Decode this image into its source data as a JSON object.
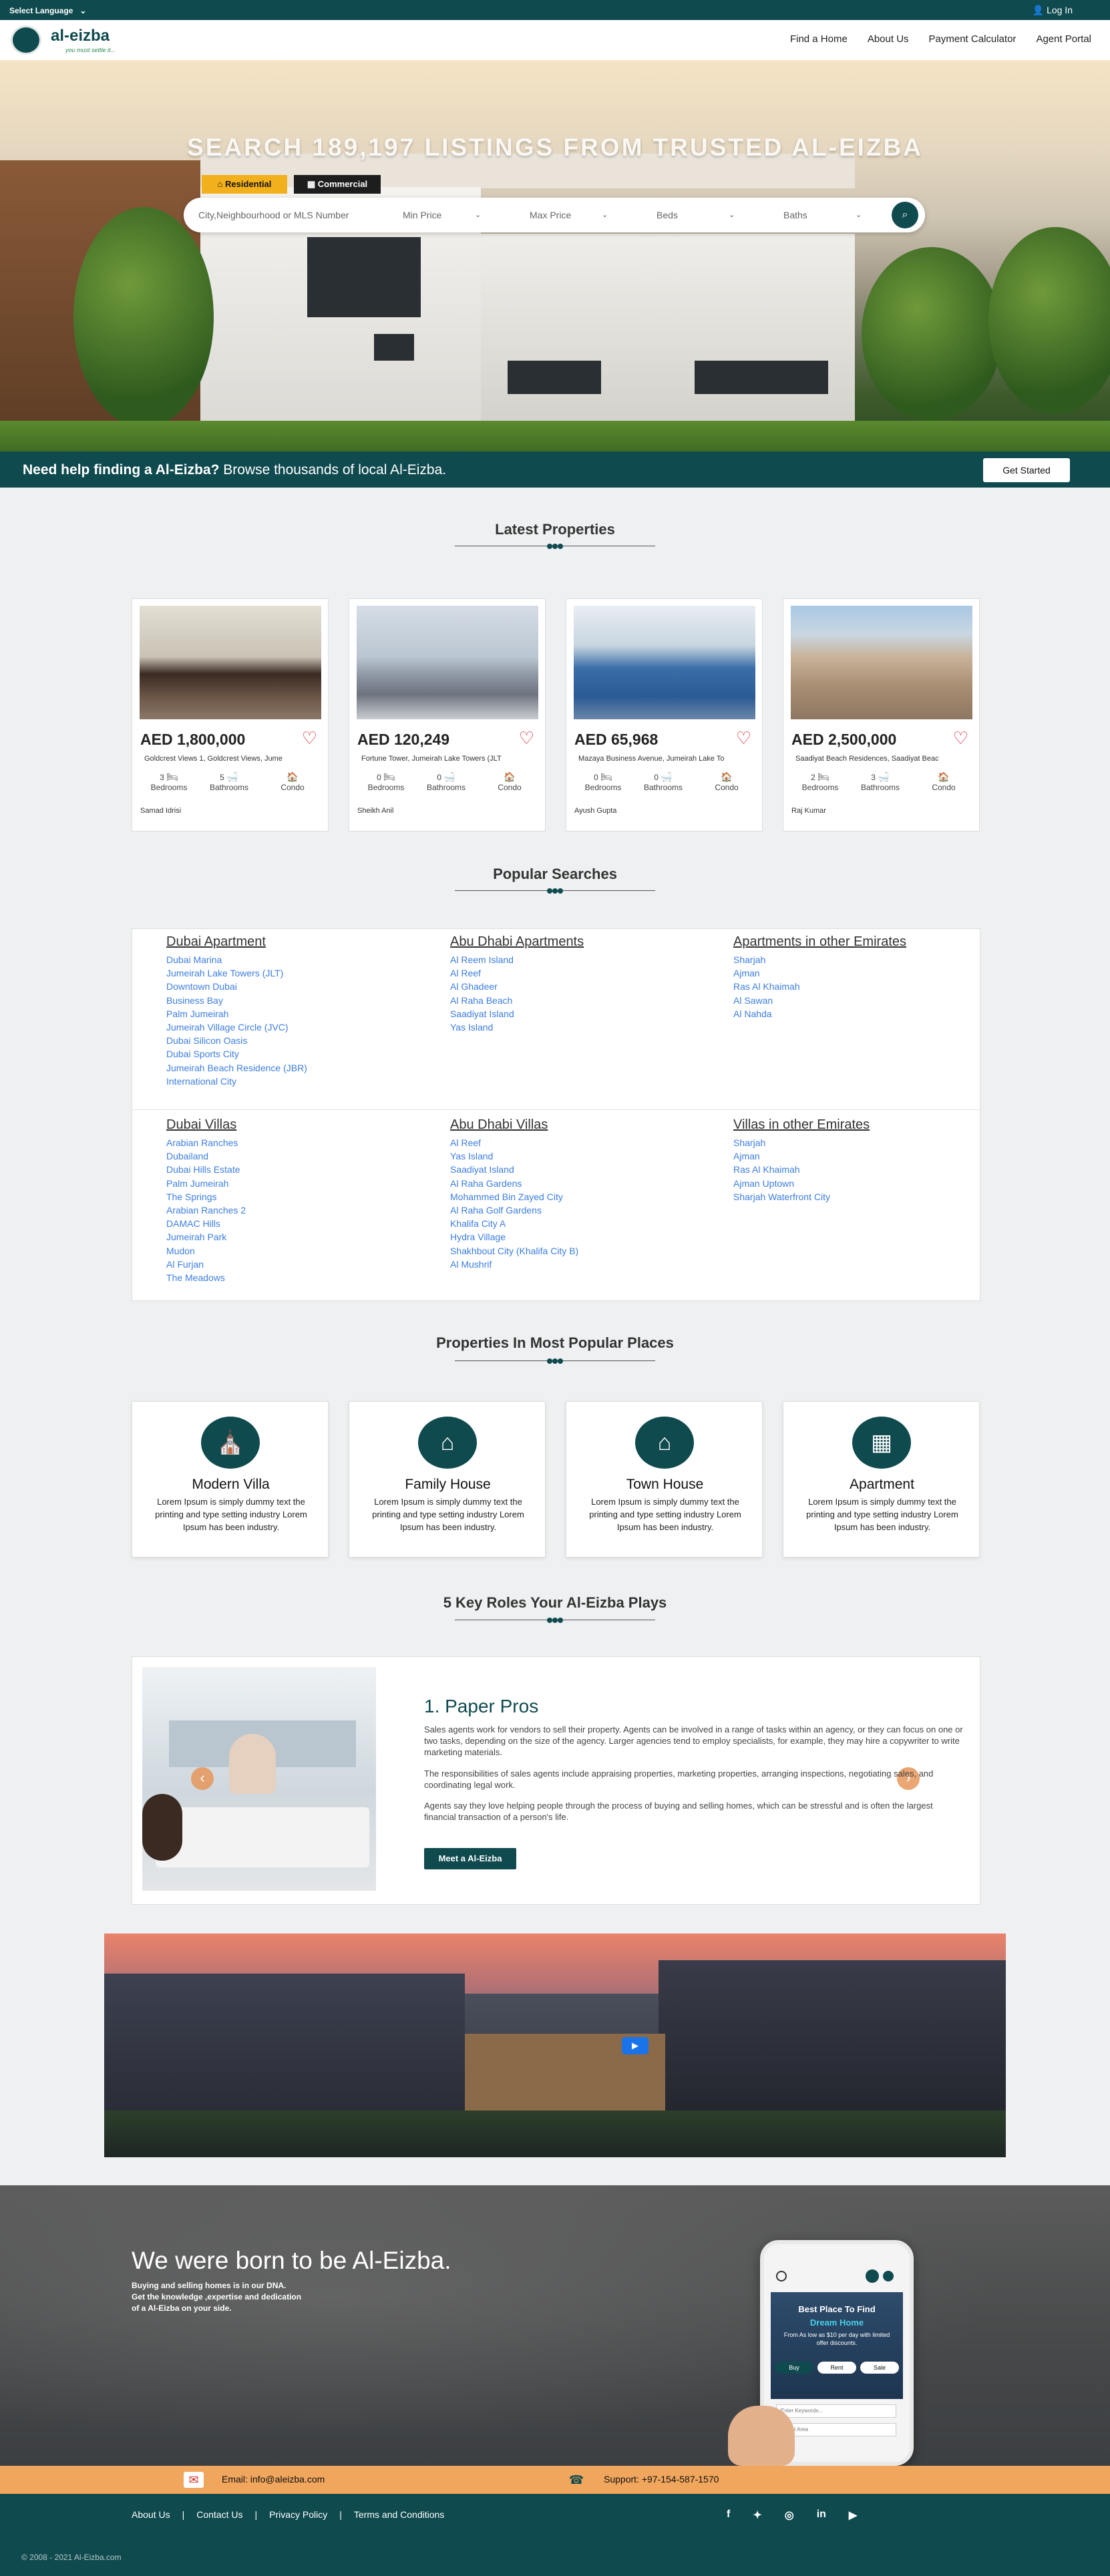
{
  "topbar": {
    "language": "Select Language",
    "login": "Log In"
  },
  "header": {
    "logo": "al-eizba",
    "tagline": "you must settle it...",
    "nav": [
      "Find a Home",
      "About Us",
      "Payment Calculator",
      "Agent Portal"
    ]
  },
  "hero": {
    "title": "SEARCH 189,197 LISTINGS FROM TRUSTED AL-EIZBA",
    "tabs": [
      "Residential",
      "Commercial"
    ],
    "search": {
      "placeholder": "City,Neighbourhood or MLS Number",
      "min_price": "Min Price",
      "max_price": "Max Price",
      "beds": "Beds",
      "baths": "Baths"
    }
  },
  "help": {
    "bold": "Need help finding a Al-Eizba?",
    "rest": " Browse thousands of local Al-Eizba.",
    "button": "Get Started"
  },
  "latest": {
    "title": "Latest Properties",
    "labels": {
      "bedrooms": "Bedrooms",
      "bathrooms": "Bathrooms",
      "type": "Condo"
    },
    "items": [
      {
        "price": "AED 1,800,000",
        "address": "Goldcrest Views 1, Goldcrest Views, Jume",
        "beds": "3",
        "baths": "5",
        "agent": "Samad Idrisi"
      },
      {
        "price": "AED 120,249",
        "address": "Fortune Tower, Jumeirah Lake Towers (JLT",
        "beds": "0",
        "baths": "0",
        "agent": "Sheikh Anil"
      },
      {
        "price": "AED 65,968",
        "address": "Mazaya Business Avenue, Jumeirah Lake To",
        "beds": "0",
        "baths": "0",
        "agent": "Ayush Gupta"
      },
      {
        "price": "AED 2,500,000",
        "address": "Saadiyat Beach Residences, Saadiyat Beac",
        "beds": "2",
        "baths": "3",
        "agent": "Raj Kumar"
      }
    ]
  },
  "popular": {
    "title": "Popular Searches",
    "groups": [
      {
        "heading": "Dubai Apartment",
        "links": [
          "Dubai Marina",
          "Jumeirah Lake Towers (JLT)",
          "Downtown Dubai",
          "Business Bay",
          "Palm Jumeirah",
          "Jumeirah Village Circle (JVC)",
          "Dubai Silicon Oasis",
          "Dubai Sports City",
          "Jumeirah Beach Residence (JBR)",
          "International City"
        ]
      },
      {
        "heading": "Abu Dhabi Apartments",
        "links": [
          "Al Reem Island",
          "Al Reef",
          "Al Ghadeer",
          "Al Raha Beach",
          "Saadiyat Island",
          "Yas Island"
        ]
      },
      {
        "heading": "Apartments in other Emirates",
        "links": [
          "Sharjah",
          "Ajman",
          "Ras Al Khaimah",
          "Al Sawan",
          "Al Nahda"
        ]
      },
      {
        "heading": "Dubai Villas",
        "links": [
          "Arabian Ranches",
          "Dubailand",
          "Dubai Hills Estate",
          "Palm Jumeirah",
          "The Springs",
          "Arabian Ranches 2",
          "DAMAC Hills",
          "Jumeirah Park",
          "Mudon",
          "Al Furjan",
          "The Meadows"
        ]
      },
      {
        "heading": "Abu Dhabi Villas",
        "links": [
          "Al Reef",
          "Yas Island",
          "Saadiyat Island",
          "Al Raha Gardens",
          "Mohammed Bin Zayed City",
          "Al Raha Golf Gardens",
          "Khalifa City A",
          "Hydra Village",
          "Shakhbout City (Khalifa City B)",
          "Al Mushrif"
        ]
      },
      {
        "heading": "Villas in other Emirates",
        "links": [
          "Sharjah",
          "Ajman",
          "Ras Al Khaimah",
          "Ajman Uptown",
          "Sharjah Waterfront City"
        ]
      }
    ]
  },
  "places": {
    "title": "Properties In Most Popular Places",
    "items": [
      {
        "title": "Modern Villa",
        "desc": "Lorem Ipsum is simply dummy text the printing and type setting industry Lorem Ipsum has been industry."
      },
      {
        "title": "Family House",
        "desc": "Lorem Ipsum is simply dummy text the printing and type setting industry Lorem Ipsum has been industry."
      },
      {
        "title": "Town House",
        "desc": "Lorem Ipsum is simply dummy text the printing and type setting industry Lorem Ipsum has been industry."
      },
      {
        "title": "Apartment",
        "desc": "Lorem Ipsum is simply dummy text the printing and type setting industry Lorem Ipsum has been industry."
      }
    ]
  },
  "roles": {
    "title": "5 Key Roles Your Al-Eizba Plays",
    "item_title": "1. Paper Pros",
    "p1": "Sales agents work for vendors to sell their property. Agents can be involved in a range of tasks within an agency, or they can focus on one or two tasks, depending on the size of the agency. Larger agencies tend to employ specialists, for example, they may hire a copywriter to write marketing materials.",
    "p2": "The responsibilities of sales agents include appraising properties, marketing properties, arranging inspections, negotiating sales, and coordinating legal work.",
    "p3": "Agents say they love helping people through the process of buying and selling homes, which can be stressful and is often the largest financial transaction of a person's life.",
    "button": "Meet a Al-Eizba"
  },
  "born": {
    "title": "We were born to be Al-Eizba.",
    "lines": [
      "Buying and selling homes is in our DNA.",
      "Get the knowledge ,expertise and dedication",
      "of a Al-Eizba on your side."
    ],
    "phone": {
      "headline": "Best Place To Find",
      "highlight": "Dream Home",
      "sub": "From As low as $10 per day with limited offer discounts.",
      "tabs": [
        "Buy",
        "Rent",
        "Sale"
      ],
      "keyword_placeholder": "Enter Keywords...",
      "area_placeholder": "Select Area"
    }
  },
  "contact": {
    "email": "Email: info@aleizba.com",
    "support": "Support: +97-154-587-1570"
  },
  "footer": {
    "links": [
      "About Us",
      "Contact Us",
      "Privacy Policy",
      "Terms and Conditions"
    ],
    "separator": "|",
    "copyright": "© 2008 - 2021 Al-Eizba.com",
    "social_icons": [
      "facebook-icon",
      "twitter-icon",
      "instagram-icon",
      "linkedin-icon",
      "youtube-icon"
    ]
  },
  "colors": {
    "primary": "#0f4a4f",
    "accent": "#f2b11c",
    "link": "#3d7ee0",
    "contact_band": "#f0a65d",
    "heart": "#e0283a"
  }
}
